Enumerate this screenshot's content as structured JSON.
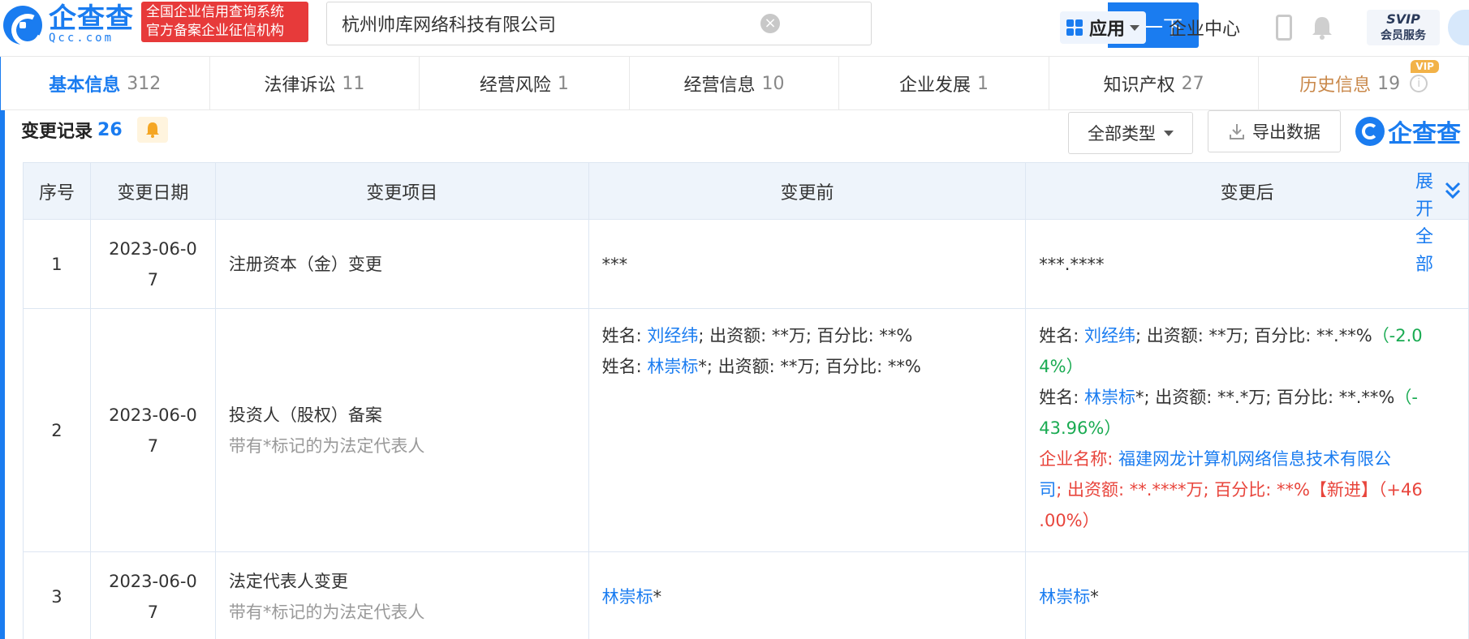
{
  "header": {
    "logo_cn": "企查查",
    "logo_en": "Qcc.com",
    "badge_line1": "全国企业信用查询系统",
    "badge_line2": "官方备案企业征信机构",
    "search_value": "杭州帅库网络科技有限公司",
    "search_button": "查一下",
    "apps_label": "应用",
    "enterprise_center": "企业中心",
    "svip_line1": "SVIP",
    "svip_line2": "会员服务"
  },
  "tabs": [
    {
      "label": "基本信息",
      "count": "312"
    },
    {
      "label": "法律诉讼",
      "count": "11"
    },
    {
      "label": "经营风险",
      "count": "1"
    },
    {
      "label": "经营信息",
      "count": "10"
    },
    {
      "label": "企业发展",
      "count": "1"
    },
    {
      "label": "知识产权",
      "count": "27"
    },
    {
      "label": "历史信息",
      "count": "19",
      "vip": "VIP"
    }
  ],
  "section": {
    "title": "变更记录",
    "count": "26",
    "type_filter": "全部类型",
    "export_label": "导出数据",
    "brand": "企查查"
  },
  "table": {
    "headers": {
      "idx": "序号",
      "date": "变更日期",
      "item": "变更项目",
      "before": "变更前",
      "after": "变更后",
      "expand": "展开全部"
    },
    "rows": [
      {
        "idx": "1",
        "date_a": "2023-06-0",
        "date_b": "7",
        "item": "注册资本（金）变更",
        "before": "***",
        "after": "***.****"
      },
      {
        "idx": "2",
        "date_a": "2023-06-0",
        "date_b": "7",
        "item": "投资人（股权）备案",
        "item_note": "带有*标记的为法定代表人",
        "before_1_prefix": "姓名: ",
        "before_1_name": "刘经纬",
        "before_1_rest": "; 出资额: **万; 百分比: **%",
        "before_2_prefix": "姓名: ",
        "before_2_name": "林崇标",
        "before_2_rest": "*; 出资额: **万; 百分比: **%",
        "after_1_prefix": "姓名: ",
        "after_1_name": "刘经纬",
        "after_1_rest": "; 出资额: **万; 百分比: **.**%",
        "after_1_change_a": "（-2.0",
        "after_1_change_b": "4%）",
        "after_2_prefix": "姓名: ",
        "after_2_name": "林崇标",
        "after_2_rest": "*; 出资额: **.*万; 百分比: **.**%",
        "after_2_change_a": "（-",
        "after_2_change_b": "43.96%）",
        "after_3_prefix": "企业名称: ",
        "after_3_name_a": "福建网龙计算机网络信息技术有限公",
        "after_3_name_b": "司",
        "after_3_rest": "; 出资额: **.****万; 百分比: **%【新进】（+46",
        "after_3_rest_b": ".00%）"
      },
      {
        "idx": "3",
        "date_a": "2023-06-0",
        "date_b": "7",
        "item": "法定代表人变更",
        "item_note": "带有*标记的为法定代表人",
        "before_name": "林崇标",
        "before_suffix": "*",
        "after_name": "林崇标",
        "after_suffix": "*"
      }
    ]
  },
  "colors": {
    "brand_blue": "#1a7cf0",
    "badge_red": "#e73a3a",
    "change_green": "#1aab52",
    "new_red": "#e8453c"
  }
}
